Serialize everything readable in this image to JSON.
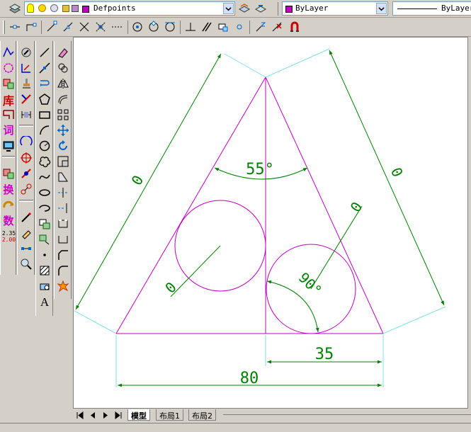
{
  "toolbar": {
    "layer_name": "Defpoints",
    "color_value": "ByLayer",
    "linetype_value": "ByLayer"
  },
  "drawing": {
    "dim_left_side": "0",
    "dim_right_side": "0",
    "dim_angle_top": "55°",
    "dim_circle_left": "0",
    "dim_circle_right": "0",
    "dim_angle_bottom": "90°",
    "dim_35": "35",
    "dim_80": "80"
  },
  "tabs": {
    "model": "模型",
    "layout1": "布局1",
    "layout2": "布局2"
  },
  "left_panel": {
    "label_lib": "库",
    "label_ci": "词",
    "label_huan": "换",
    "label_shu": "数",
    "label_235": "2.35",
    "label_200": "2.00",
    "text_tool": "A"
  },
  "colors": {
    "magenta": "#c000c0",
    "green": "#008000",
    "cyan": "#80e0e8"
  }
}
